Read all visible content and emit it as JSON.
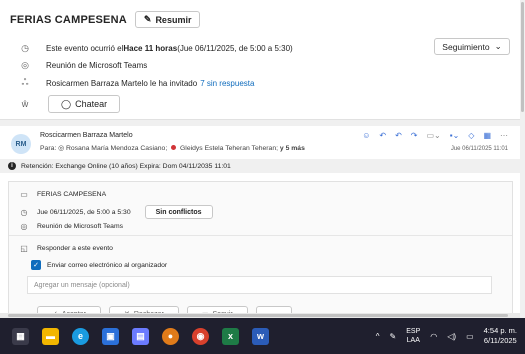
{
  "summary": {
    "title": "FERIAS CAMPESENA",
    "resumir_label": "Resumir",
    "occurred_prefix": "Este evento ocurrió el ",
    "occurred_bold": "Hace 11 horas",
    "occurred_suffix": " (Jue 06/11/2025, de 5:00 a 5:30)",
    "seguimiento_label": "Seguimiento",
    "location": "Reunión de Microsoft Teams",
    "invite_text": "Rosicarmen Barraza Martelo le ha invitado",
    "no_response_link": "7 sin respuesta",
    "chat_label": "Chatear"
  },
  "message": {
    "avatar_initials": "RM",
    "sender": "Roscicarmen Barraza Martelo",
    "to_prefix": "Para: ",
    "recipient_1": "Rosana María Mendoza Casiano;",
    "recipient_2": "Gleidys Estela Teheran Teheran;",
    "more": "y 5 más",
    "date": "Jue 06/11/2025 11:01",
    "retention": "Retención: Exchange Online (10 años) Expira: Dom 04/11/2035 11:01"
  },
  "event": {
    "title": "FERIAS CAMPESENA",
    "time": "Jue 06/11/2025, de 5:00 a 5:30",
    "conflicts_label": "Sin conflictos",
    "location": "Reunión de Microsoft Teams",
    "respond_label": "Responder a este evento",
    "email_organizer_label": "Enviar correo electrónico al organizador",
    "message_placeholder": "Agregar un mensaje (opcional)",
    "accept_label": "Aceptar",
    "decline_label": "Rechazar",
    "follow_label": "Seguir",
    "more_label": "..."
  },
  "taskbar": {
    "lang_top": "ESP",
    "lang_bottom": "LAA",
    "time": "4:54 p. m.",
    "date": "6/11/2025"
  },
  "colors": {
    "accent": "#0f6cbd",
    "taskbar": "#1f1f2e",
    "busy_red": "#d13438"
  }
}
